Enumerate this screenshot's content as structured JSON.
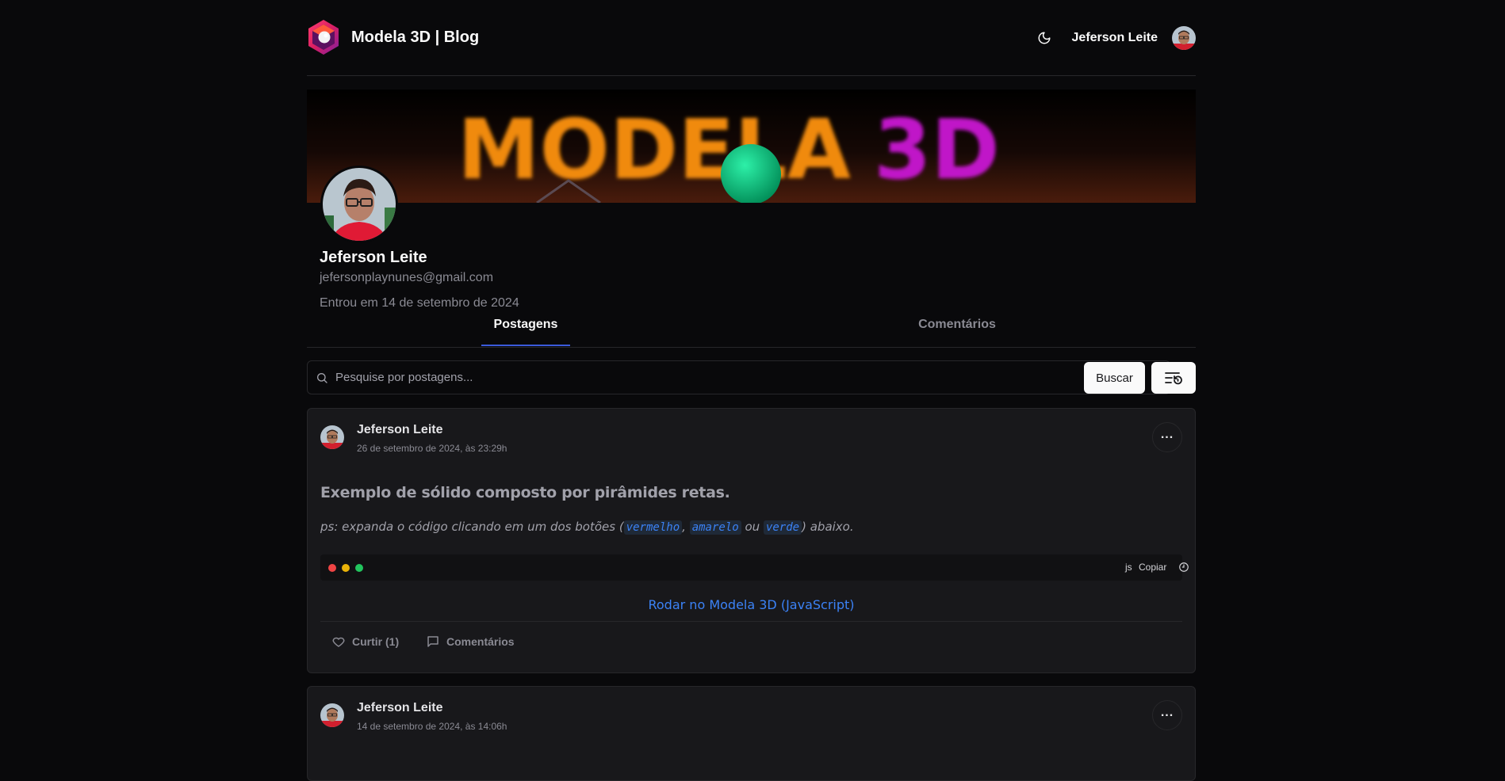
{
  "header": {
    "brand_title": "Modela 3D | Blog",
    "user_name": "Jeferson Leite",
    "icons": {
      "theme": "moon-icon",
      "logo": "modela-logo-icon"
    }
  },
  "banner": {
    "text": "MODELA 3D"
  },
  "profile": {
    "name": "Jeferson Leite",
    "email": "jefersonplaynunes@gmail.com",
    "joined": "Entrou em 14 de setembro de 2024"
  },
  "tabs": [
    {
      "label": "Postagens",
      "active": true
    },
    {
      "label": "Comentários",
      "active": false
    }
  ],
  "search": {
    "placeholder": "Pesquise por postagens...",
    "button_label": "Buscar"
  },
  "posts": [
    {
      "author": "Jeferson Leite",
      "date": "26 de setembro de 2024, às 23:29h",
      "title": "Exemplo de sólido composto por pirâmides retas.",
      "ps_prefix": "ps: expanda o código clicando em um dos botões (",
      "ps_code1": "vermelho",
      "ps_sep1": ",",
      "ps_code2": "amarelo",
      "ps_mid": "ou",
      "ps_code3": "verde",
      "ps_suffix": ") abaixo.",
      "code_lang": "js",
      "code_copy": "Copiar",
      "run_link": "Rodar no Modela 3D (JavaScript)",
      "like_label": "Curtir (1)",
      "comments_label": "Comentários"
    },
    {
      "author": "Jeferson Leite",
      "date": "14 de setembro de 2024, às 14:06h"
    }
  ],
  "colors": {
    "background": "#09090b",
    "card": "#18181b",
    "border": "#27272a",
    "accent": "#3b5bdb",
    "link": "#3b82f6"
  }
}
